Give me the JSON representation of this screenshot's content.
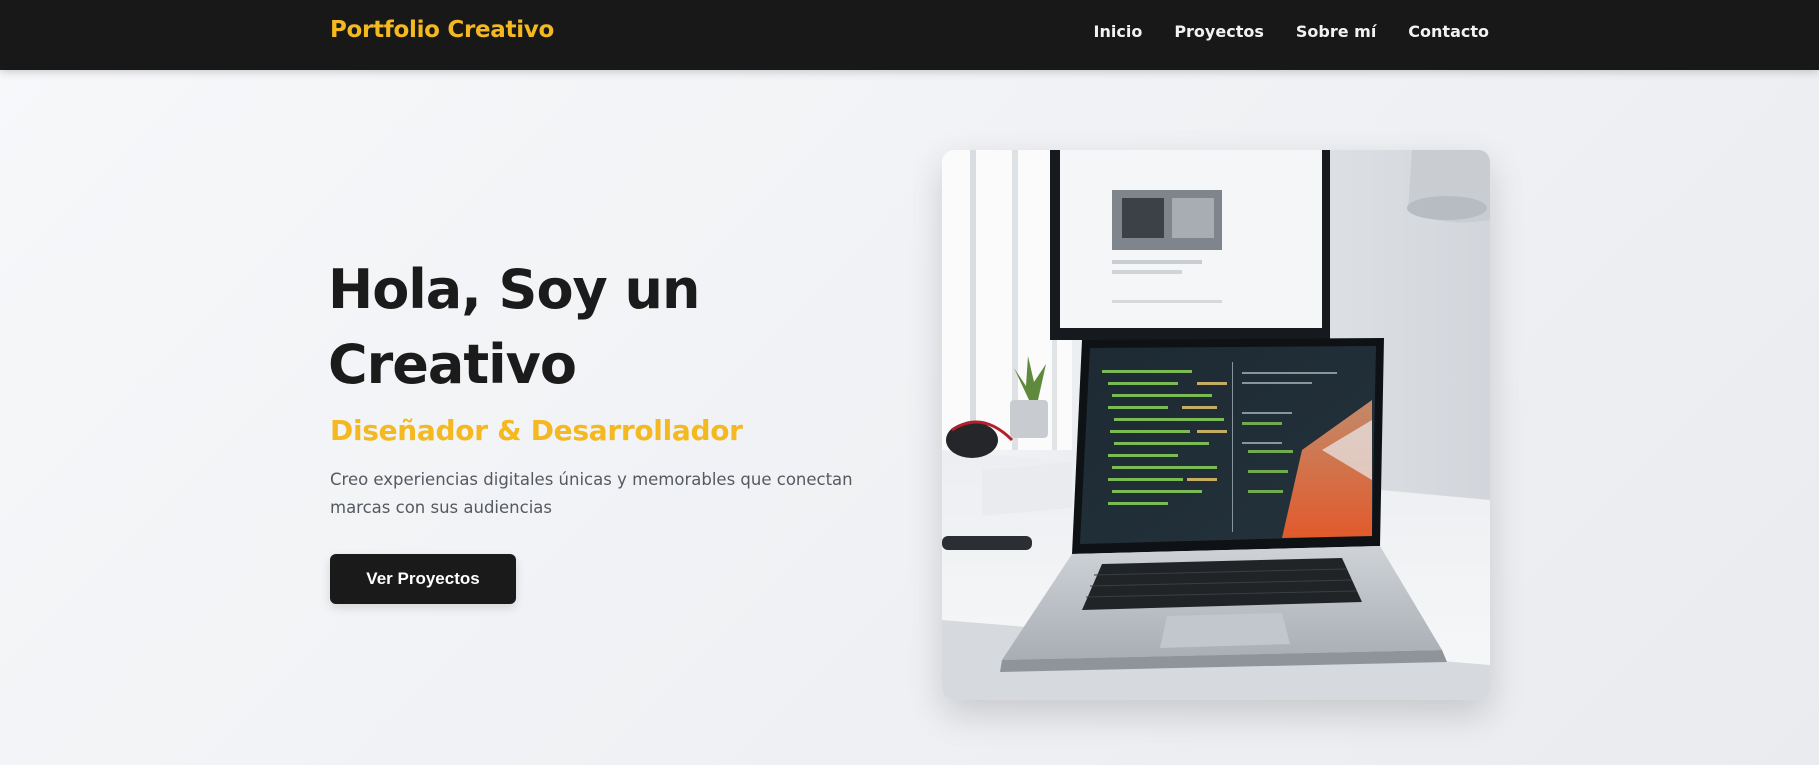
{
  "navbar": {
    "brand": "Portfolio Creativo",
    "links": [
      {
        "label": "Inicio"
      },
      {
        "label": "Proyectos"
      },
      {
        "label": "Sobre mí"
      },
      {
        "label": "Contacto"
      }
    ]
  },
  "hero": {
    "title": "Hola, Soy un Creativo",
    "subtitle": "Diseñador & Desarrollador",
    "description": "Creo experiencias digitales únicas y memorables que conectan marcas con sus audiencias",
    "cta_label": "Ver Proyectos",
    "image_icon": "laptop-workspace-photo"
  },
  "colors": {
    "accent": "#f4b820",
    "navbar_bg": "#181818",
    "button_bg": "#1a1a1a",
    "text_dark": "#1b1b1b",
    "text_muted": "#555a60"
  }
}
